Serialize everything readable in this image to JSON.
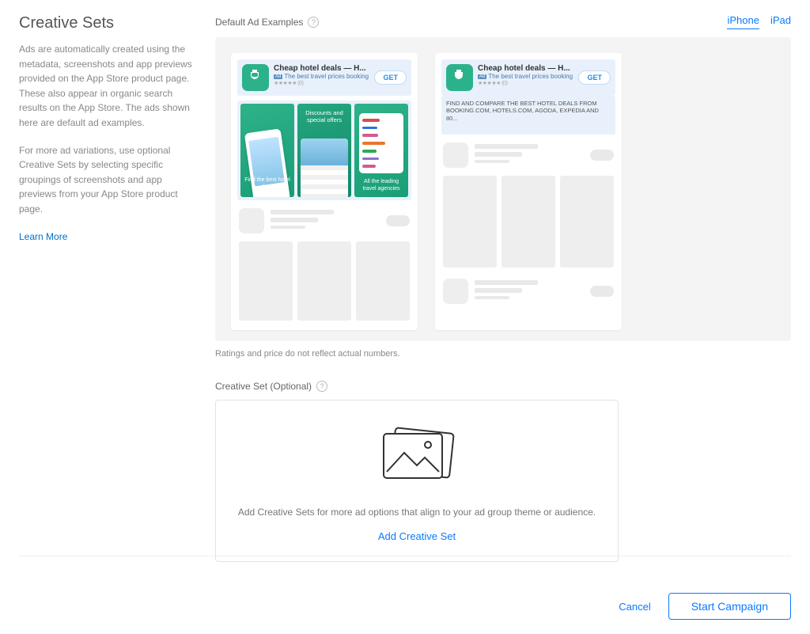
{
  "left": {
    "title": "Creative Sets",
    "p1": "Ads are automatically created using the metadata, screenshots and app previews provided on the App Store product page. These also appear in organic search results on the App Store. The ads shown here are default ad examples.",
    "p2": "For more ad variations, use optional Creative Sets by selecting specific groupings of screenshots and app previews from your App Store product page.",
    "learn_more": "Learn More"
  },
  "examples": {
    "label": "Default Ad Examples",
    "tab_iphone": "iPhone",
    "tab_ipad": "iPad",
    "app_title": "Cheap hotel deals — H...",
    "app_subtitle": "The best travel prices booking",
    "ad_badge": "Ad",
    "stars": "★★★★★",
    "stars_count": "(0)",
    "get": "GET",
    "shot1": "Find the best hotel deals",
    "shot2": "Discounts and special offers",
    "shot3": "All the leading travel agencies",
    "desc": "FIND AND COMPARE THE BEST HOTEL DEALS FROM BOOKING.COM, HOTELS.COM, AGODA, EXPEDIA AND 80...",
    "disclaimer": "Ratings and price do not reflect actual numbers."
  },
  "creative_set": {
    "label": "Creative Set (Optional)",
    "text": "Add Creative Sets for more ad options that align to your ad group theme or audience.",
    "add_link": "Add Creative Set"
  },
  "footer": {
    "cancel": "Cancel",
    "start": "Start Campaign"
  }
}
